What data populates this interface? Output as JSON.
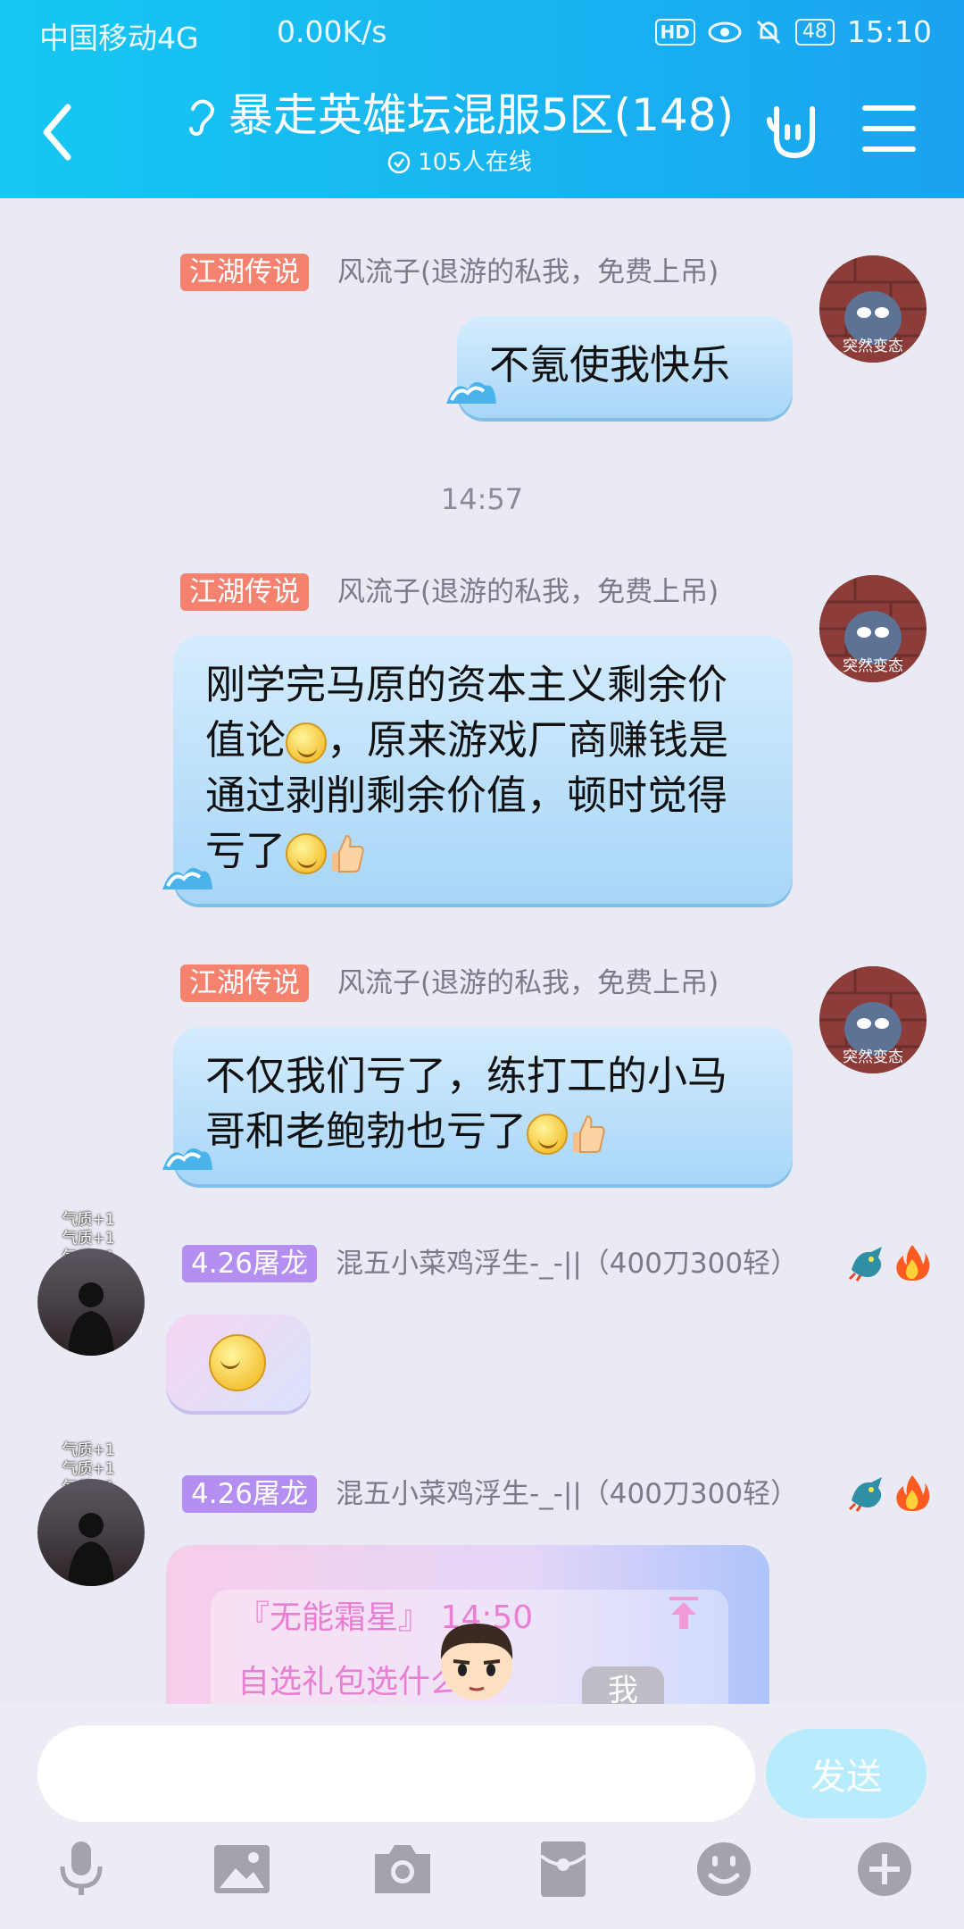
{
  "status_bar": {
    "carrier": "中国移动4G",
    "network_speed": "0.00K/s",
    "hd": "HD",
    "battery": "48",
    "time": "15:10"
  },
  "header": {
    "title": "暴走英雄坛混服5区(148)",
    "online_count": "105人在线"
  },
  "messages": [
    {
      "tag": "江湖传说",
      "nickname": "风流子(退游的私我，免费上吊)",
      "avatar_label": "突然变态",
      "text": "不氪使我快乐"
    },
    {
      "timestamp": "14:57"
    },
    {
      "tag": "江湖传说",
      "nickname": "风流子(退游的私我，免费上吊)",
      "avatar_label": "突然变态",
      "text_parts": [
        "刚学完马原的资本主义剩余价值论",
        "，原来游戏厂商赚钱是通过剥削剩余价值，顿时觉得亏了"
      ]
    },
    {
      "tag": "江湖传说",
      "nickname": "风流子(退游的私我，免费上吊)",
      "avatar_label": "突然变态",
      "text": "不仅我们亏了，练打工的小马哥和老鲍勃也亏了"
    },
    {
      "tag": "4.26屠龙",
      "nickname": "混五小菜鸡浮生-_-||（400刀300轻）",
      "avatar_labels": [
        "气质+1",
        "气质+1",
        "气质+1"
      ]
    },
    {
      "tag": "4.26屠龙",
      "nickname": "混五小菜鸡浮生-_-||（400刀300轻）",
      "avatar_labels": [
        "气质+1",
        "气质+1",
        "气质+1"
      ],
      "card_title": "『无能霜星』 14:50",
      "card_text": "自选礼包选什么啊",
      "me_label": "我"
    }
  ],
  "input_bar": {
    "placeholder": "",
    "send_label": "发送"
  },
  "colors": {
    "header_start": "#16c8f2",
    "header_end": "#1aa3f0",
    "tag_red": "#f4826f",
    "tag_purple": "#b48ef0",
    "background": "#eaeaf4"
  },
  "icons": [
    "back-arrow-icon",
    "ear-icon",
    "check-circle-icon",
    "rock-hand-icon",
    "menu-icon",
    "mic-icon",
    "image-icon",
    "camera-icon",
    "red-packet-icon",
    "emoji-icon",
    "plus-icon",
    "dragon-badge-icon",
    "fire-badge-icon",
    "wave-icon"
  ]
}
